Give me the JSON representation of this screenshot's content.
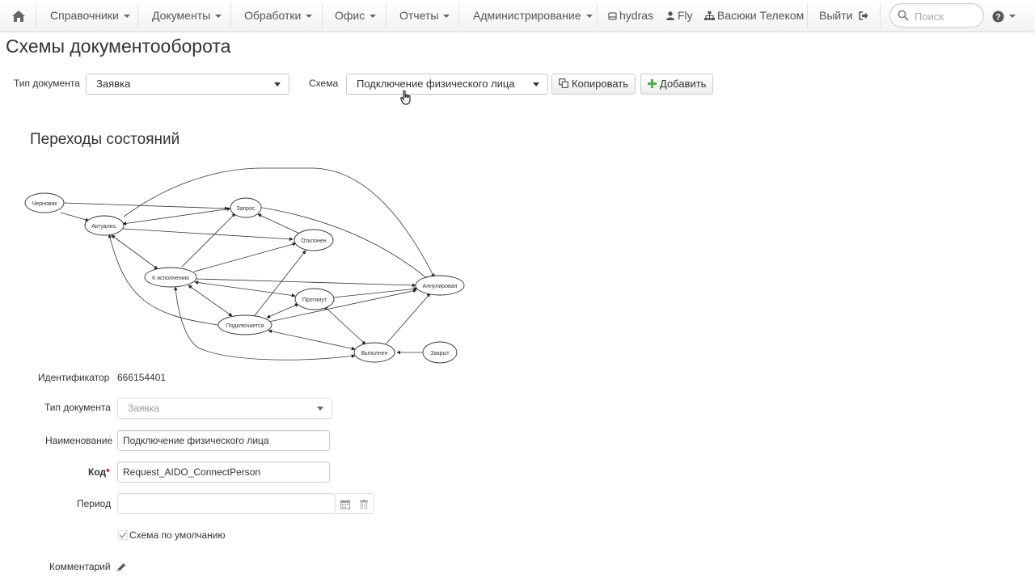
{
  "navbar": {
    "home_icon": "home-icon",
    "menus": [
      "Справочники",
      "Документы",
      "Обработки",
      "Офис",
      "Отчеты",
      "Администрирование"
    ],
    "server": "hydras",
    "user": "Fly",
    "company": "Васюки Телеком",
    "logout": "Выйти",
    "search_placeholder": "Поиск"
  },
  "page": {
    "title": "Схемы документооборота",
    "doc_type_label": "Тип документа",
    "doc_type_value": "Заявка",
    "scheme_label": "Схема",
    "scheme_value": "Подключение физического лица",
    "copy_button": "Копировать",
    "add_button": "Добавить"
  },
  "graph": {
    "title": "Переходы состояний",
    "nodes": {
      "draft": "Черновик",
      "actualized": "Актуализ.",
      "request": "Запрос",
      "rejected": "Отклонен",
      "execution": "К исполнению",
      "stretched": "Протянут",
      "cancelled": "Аннулирован",
      "connecting": "Подключается",
      "done": "Выполнен",
      "closed": "Закрыт"
    }
  },
  "form": {
    "id_label": "Идентификатор",
    "id_value": "666154401",
    "doc_type_label": "Тип документа",
    "doc_type_value": "Заявка",
    "name_label": "Наименование",
    "name_value": "Подключение физического лица",
    "code_label": "Код",
    "code_required": "*",
    "code_value": "Request_AIDO_ConnectPerson",
    "period_label": "Период",
    "period_value": "",
    "default_label": "Схема по умолчанию",
    "default_checked": true,
    "comment_label": "Комментарий"
  }
}
